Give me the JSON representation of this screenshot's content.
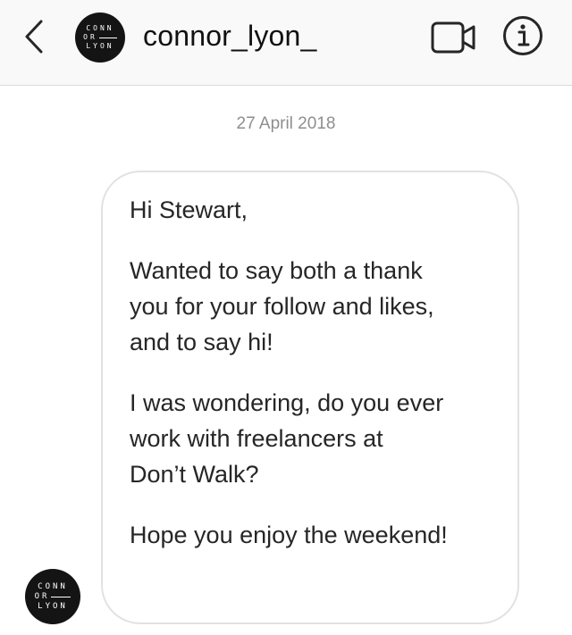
{
  "header": {
    "username": "connor_lyon_",
    "avatar_logo": {
      "line1": "CONN",
      "line2": "OR",
      "line3": "LYON"
    },
    "icons": {
      "back": "chevron-left-icon",
      "video": "video-camera-icon",
      "info": "info-icon"
    }
  },
  "thread": {
    "date": "27 April 2018",
    "message": {
      "paragraphs": [
        "Hi Stewart,",
        "Wanted to say both a thank\nyou for your follow and likes,\nand to say hi!",
        "I was wondering, do you ever\nwork with freelancers at\nDon’t Walk?",
        "Hope you enjoy the weekend!"
      ],
      "sender_avatar_logo": {
        "line1": "CONN",
        "line2": "OR",
        "line3": "LYON"
      }
    }
  },
  "colors": {
    "header_bg": "#f9f9f9",
    "text": "#262626",
    "date_text": "#8e8e8e",
    "bubble_border": "#e2e2e2",
    "avatar_bg": "#141414"
  }
}
